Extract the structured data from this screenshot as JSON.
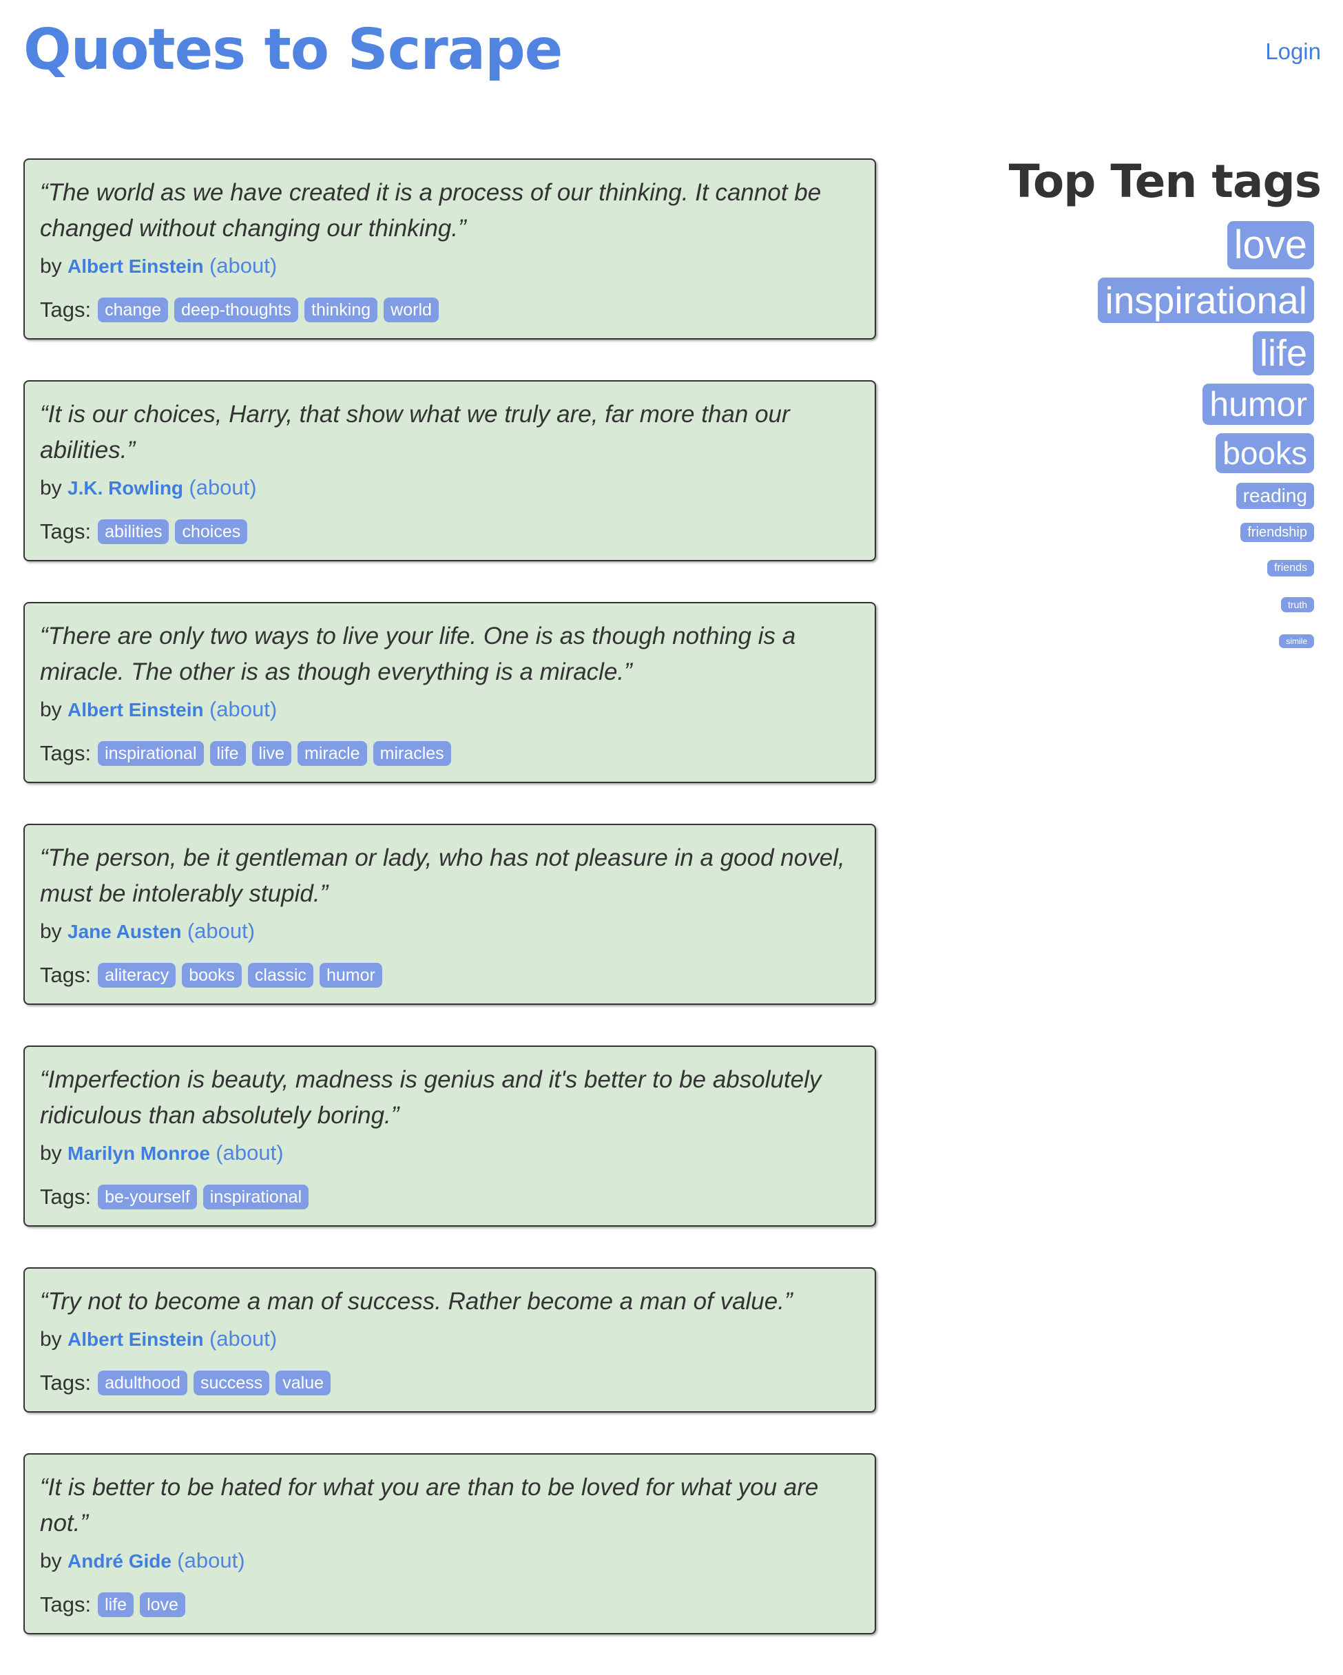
{
  "header": {
    "title": "Quotes to Scrape",
    "login": "Login"
  },
  "quotes": [
    {
      "text": "“The world as we have created it is a process of our thinking. It cannot be changed without changing our thinking.”",
      "by": "by",
      "author": "Albert Einstein",
      "about": "(about)",
      "tags_label": "Tags:",
      "tags": [
        "change",
        "deep-thoughts",
        "thinking",
        "world"
      ]
    },
    {
      "text": "“It is our choices, Harry, that show what we truly are, far more than our abilities.”",
      "by": "by",
      "author": "J.K. Rowling",
      "about": "(about)",
      "tags_label": "Tags:",
      "tags": [
        "abilities",
        "choices"
      ]
    },
    {
      "text": "“There are only two ways to live your life. One is as though nothing is a miracle. The other is as though everything is a miracle.”",
      "by": "by",
      "author": "Albert Einstein",
      "about": "(about)",
      "tags_label": "Tags:",
      "tags": [
        "inspirational",
        "life",
        "live",
        "miracle",
        "miracles"
      ]
    },
    {
      "text": "“The person, be it gentleman or lady, who has not pleasure in a good novel, must be intolerably stupid.”",
      "by": "by",
      "author": "Jane Austen",
      "about": "(about)",
      "tags_label": "Tags:",
      "tags": [
        "aliteracy",
        "books",
        "classic",
        "humor"
      ]
    },
    {
      "text": "“Imperfection is beauty, madness is genius and it's better to be absolutely ridiculous than absolutely boring.”",
      "by": "by",
      "author": "Marilyn Monroe",
      "about": "(about)",
      "tags_label": "Tags:",
      "tags": [
        "be-yourself",
        "inspirational"
      ]
    },
    {
      "text": "“Try not to become a man of success. Rather become a man of value.”",
      "by": "by",
      "author": "Albert Einstein",
      "about": "(about)",
      "tags_label": "Tags:",
      "tags": [
        "adulthood",
        "success",
        "value"
      ]
    },
    {
      "text": "“It is better to be hated for what you are than to be loved for what you are not.”",
      "by": "by",
      "author": "André Gide",
      "about": "(about)",
      "tags_label": "Tags:",
      "tags": [
        "life",
        "love"
      ]
    }
  ],
  "sidebar": {
    "title": "Top Ten tags",
    "tags": [
      "love",
      "inspirational",
      "life",
      "humor",
      "books",
      "reading",
      "friendship",
      "friends",
      "truth",
      "simile"
    ]
  },
  "colors": {
    "link": "#5184e0",
    "quote_bg": "#d8e9d6",
    "tag_bg": "#7f9ce5"
  }
}
